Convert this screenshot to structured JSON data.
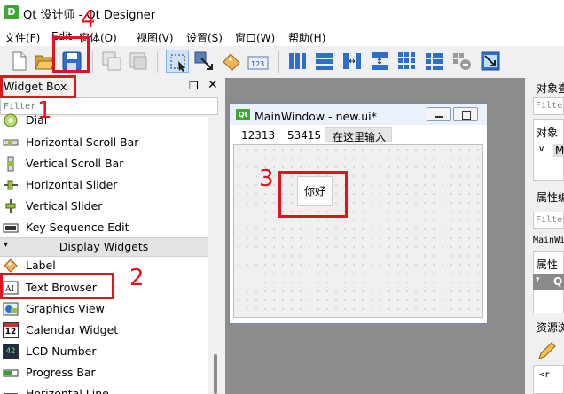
{
  "window": {
    "title": "Qt 设计师 - Qt Designer",
    "icon": "qt-logo-icon"
  },
  "menubar": {
    "items": [
      "文件(F)",
      "Edit",
      "窗体(O)",
      "视图(V)",
      "设置(S)",
      "窗口(W)",
      "帮助(H)"
    ]
  },
  "toolbar": {
    "icons": [
      "new-file-icon",
      "open-folder-icon",
      "save-icon",
      "copy-icon",
      "paste-icon",
      "edit-widgets-icon",
      "edit-signals-slots-icon",
      "edit-buddies-icon",
      "edit-tab-order-icon",
      "layout-horizontal-icon",
      "layout-vertical-icon",
      "layout-horizontal-splitter-icon",
      "layout-vertical-splitter-icon",
      "layout-grid-icon",
      "layout-form-icon",
      "break-layout-icon",
      "adjust-size-icon"
    ]
  },
  "widget_box": {
    "title": "Widget Box",
    "float_icon": "float-icon",
    "close_icon": "close-icon",
    "filter_placeholder": "Filter",
    "items_before": [
      {
        "label": "Dial",
        "icon": "dial-icon"
      },
      {
        "label": "Horizontal Scroll Bar",
        "icon": "horizontal-scroll-bar-icon"
      },
      {
        "label": "Vertical Scroll Bar",
        "icon": "vertical-scroll-bar-icon"
      },
      {
        "label": "Horizontal Slider",
        "icon": "horizontal-slider-icon"
      },
      {
        "label": "Vertical Slider",
        "icon": "vertical-slider-icon"
      },
      {
        "label": "Key Sequence Edit",
        "icon": "key-sequence-edit-icon"
      }
    ],
    "category": "Display Widgets",
    "items_after": [
      {
        "label": "Label",
        "icon": "label-icon"
      },
      {
        "label": "Text Browser",
        "icon": "text-browser-icon"
      },
      {
        "label": "Graphics View",
        "icon": "graphics-view-icon"
      },
      {
        "label": "Calendar Widget",
        "icon": "calendar-widget-icon",
        "glyph": "12"
      },
      {
        "label": "LCD Number",
        "icon": "lcd-number-icon",
        "glyph": "42"
      },
      {
        "label": "Progress Bar",
        "icon": "progress-bar-icon"
      },
      {
        "label": "Horizontal Line",
        "icon": "horizontal-line-icon"
      }
    ]
  },
  "form": {
    "title": "MainWindow - new.ui*",
    "icon_text": "Qt",
    "menu_items": [
      "12313",
      "53415"
    ],
    "type_here": "在这里输入",
    "button_text": "你好"
  },
  "right_panel": {
    "object_inspector_title": "对象查",
    "filter1": "Filte",
    "object_header": "对象",
    "tree_item": "M",
    "property_editor_title": "属性编",
    "filter2": "Filte",
    "class_name": "MainWi",
    "property_header": "属性",
    "property_group": "Q",
    "resource_title": "资源浏",
    "resource_text": "<r"
  },
  "annotations": {
    "numbers": [
      "1",
      "2",
      "3",
      "4"
    ],
    "color": "#e0141e"
  }
}
